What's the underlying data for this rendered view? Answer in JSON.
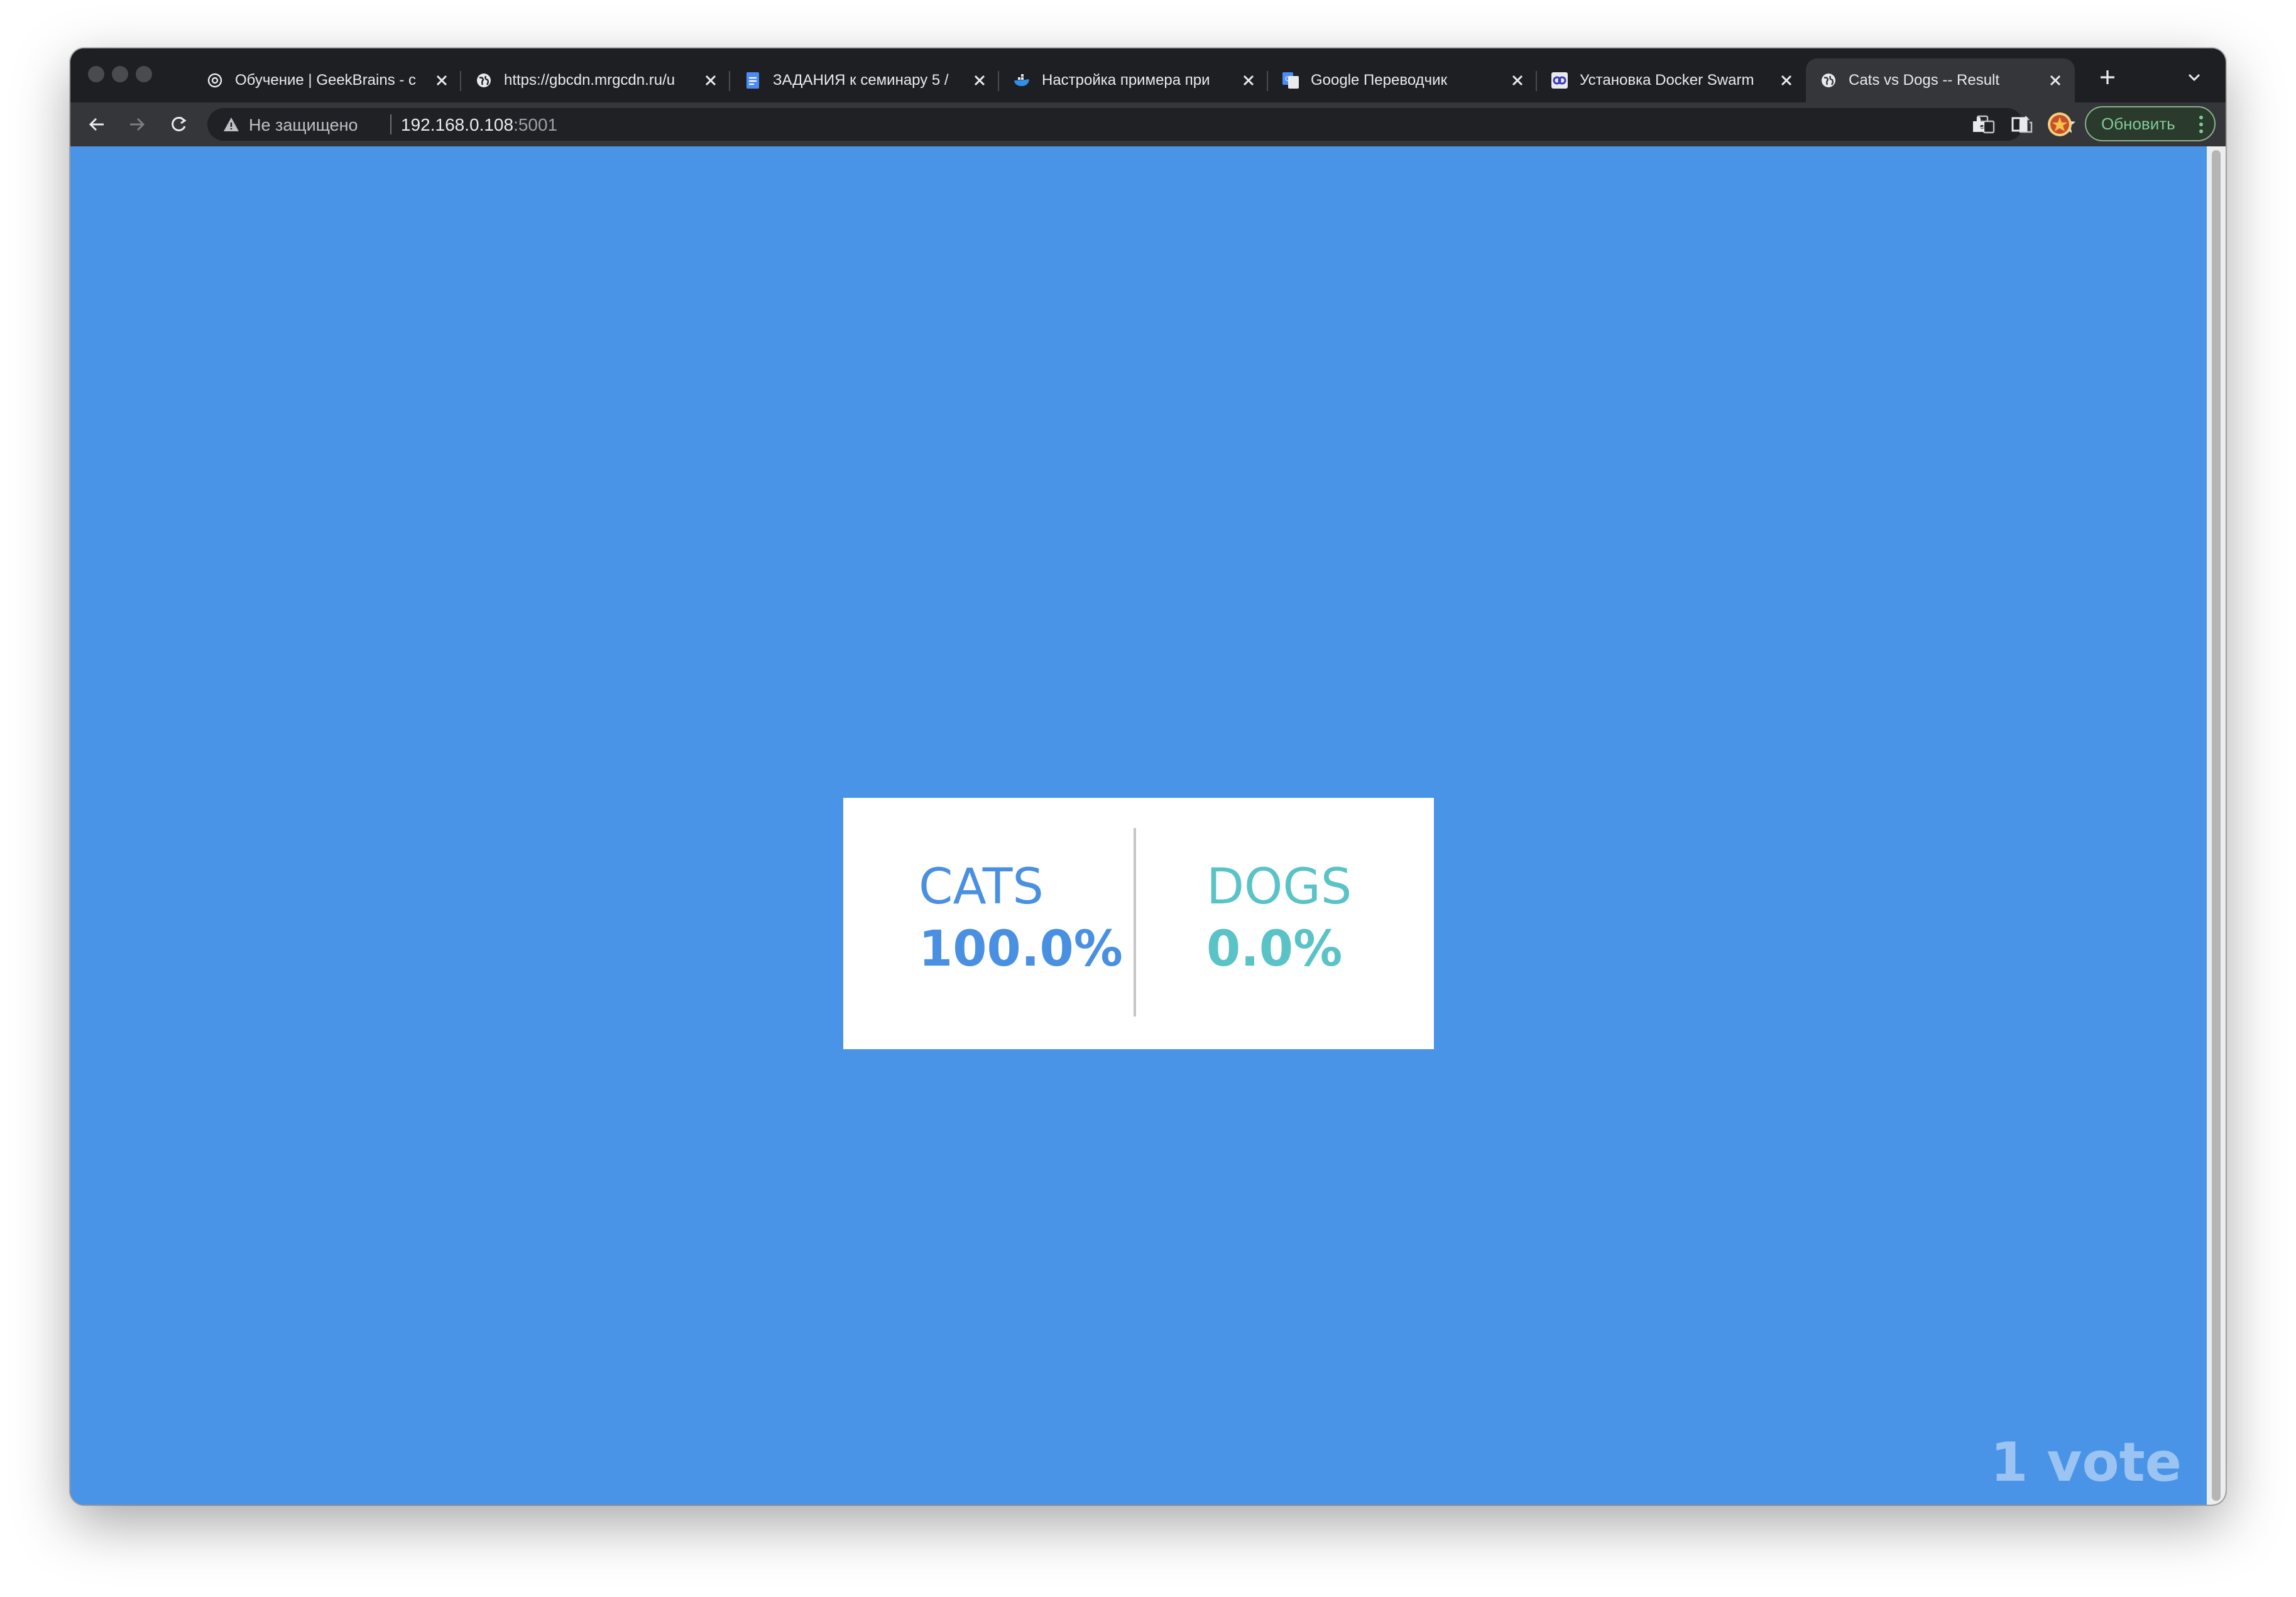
{
  "browser": {
    "tabs": [
      {
        "title": "Обучение | GeekBrains - с",
        "icon": "chatgpt-icon",
        "active": false
      },
      {
        "title": "https://gbcdn.mrgcdn.ru/u",
        "icon": "globe-icon",
        "active": false
      },
      {
        "title": "ЗАДАНИЯ к семинару 5 /",
        "icon": "google-docs-icon",
        "active": false
      },
      {
        "title": "Настройка примера при",
        "icon": "docker-icon",
        "active": false
      },
      {
        "title": "Google Переводчик",
        "icon": "google-translate-icon",
        "active": false
      },
      {
        "title": "Установка Docker Swarm",
        "icon": "site-icon",
        "active": false
      },
      {
        "title": "Cats vs Dogs -- Result",
        "icon": "globe-icon",
        "active": true
      }
    ],
    "address_bar": {
      "security_label": "Не защищено",
      "host": "192.168.0.108",
      "port": ":5001"
    },
    "update_button_label": "Обновить"
  },
  "result": {
    "cats": {
      "label": "CATS",
      "percent": "100.0%",
      "color": "#4a90e2"
    },
    "dogs": {
      "label": "DOGS",
      "percent": "0.0%",
      "color": "#5ac3c7"
    },
    "vote_count_text": "1 vote"
  },
  "colors": {
    "page_background": "#4a94e8",
    "card_background": "#ffffff"
  }
}
